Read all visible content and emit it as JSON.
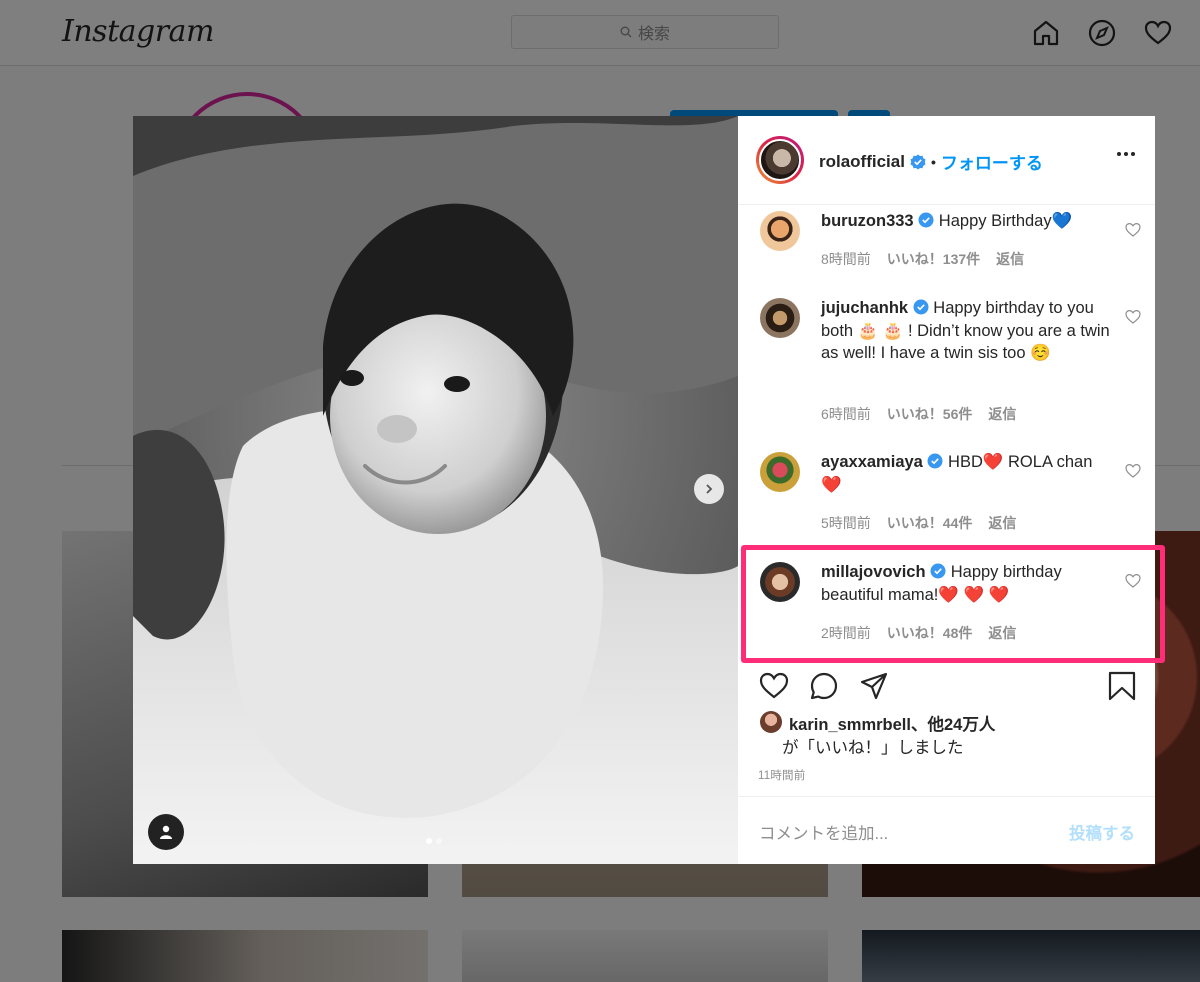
{
  "topnav": {
    "logo": "Instagram",
    "search_placeholder": "検索"
  },
  "post": {
    "username": "rolaofficial",
    "follow_label": "フォローする",
    "separator": "•",
    "comments": [
      {
        "user": "buruzon333",
        "text": "Happy Birthday💙",
        "time": "8時間前",
        "likes": "いいね！137件",
        "reply": "返信"
      },
      {
        "user": "jujuchanhk",
        "text": "Happy birthday to you both 🎂 🎂 ! Didn’t know you are a twin as well! I have a twin sis too ☺️",
        "time": "6時間前",
        "likes": "いいね！56件",
        "reply": "返信"
      },
      {
        "user": "ayaxxamiaya",
        "text": "HBD❤️ ROLA chan ❤️",
        "time": "5時間前",
        "likes": "いいね！44件",
        "reply": "返信"
      },
      {
        "user": "millajovovich",
        "text": "Happy birthday beautiful mama!❤️ ❤️ ❤️",
        "time": "2時間前",
        "likes": "いいね！48件",
        "reply": "返信"
      }
    ],
    "liked_by": {
      "user": "karin_smmrbell、他24万人",
      "suffix": "が「いいね！」しました"
    },
    "posted_time": "11時間前",
    "comment_placeholder": "コメントを追加...",
    "post_button": "投稿する"
  },
  "colors": {
    "accent": "#0095f6",
    "highlight": "#ff2d78",
    "disabled_post": "#b2dffc"
  }
}
